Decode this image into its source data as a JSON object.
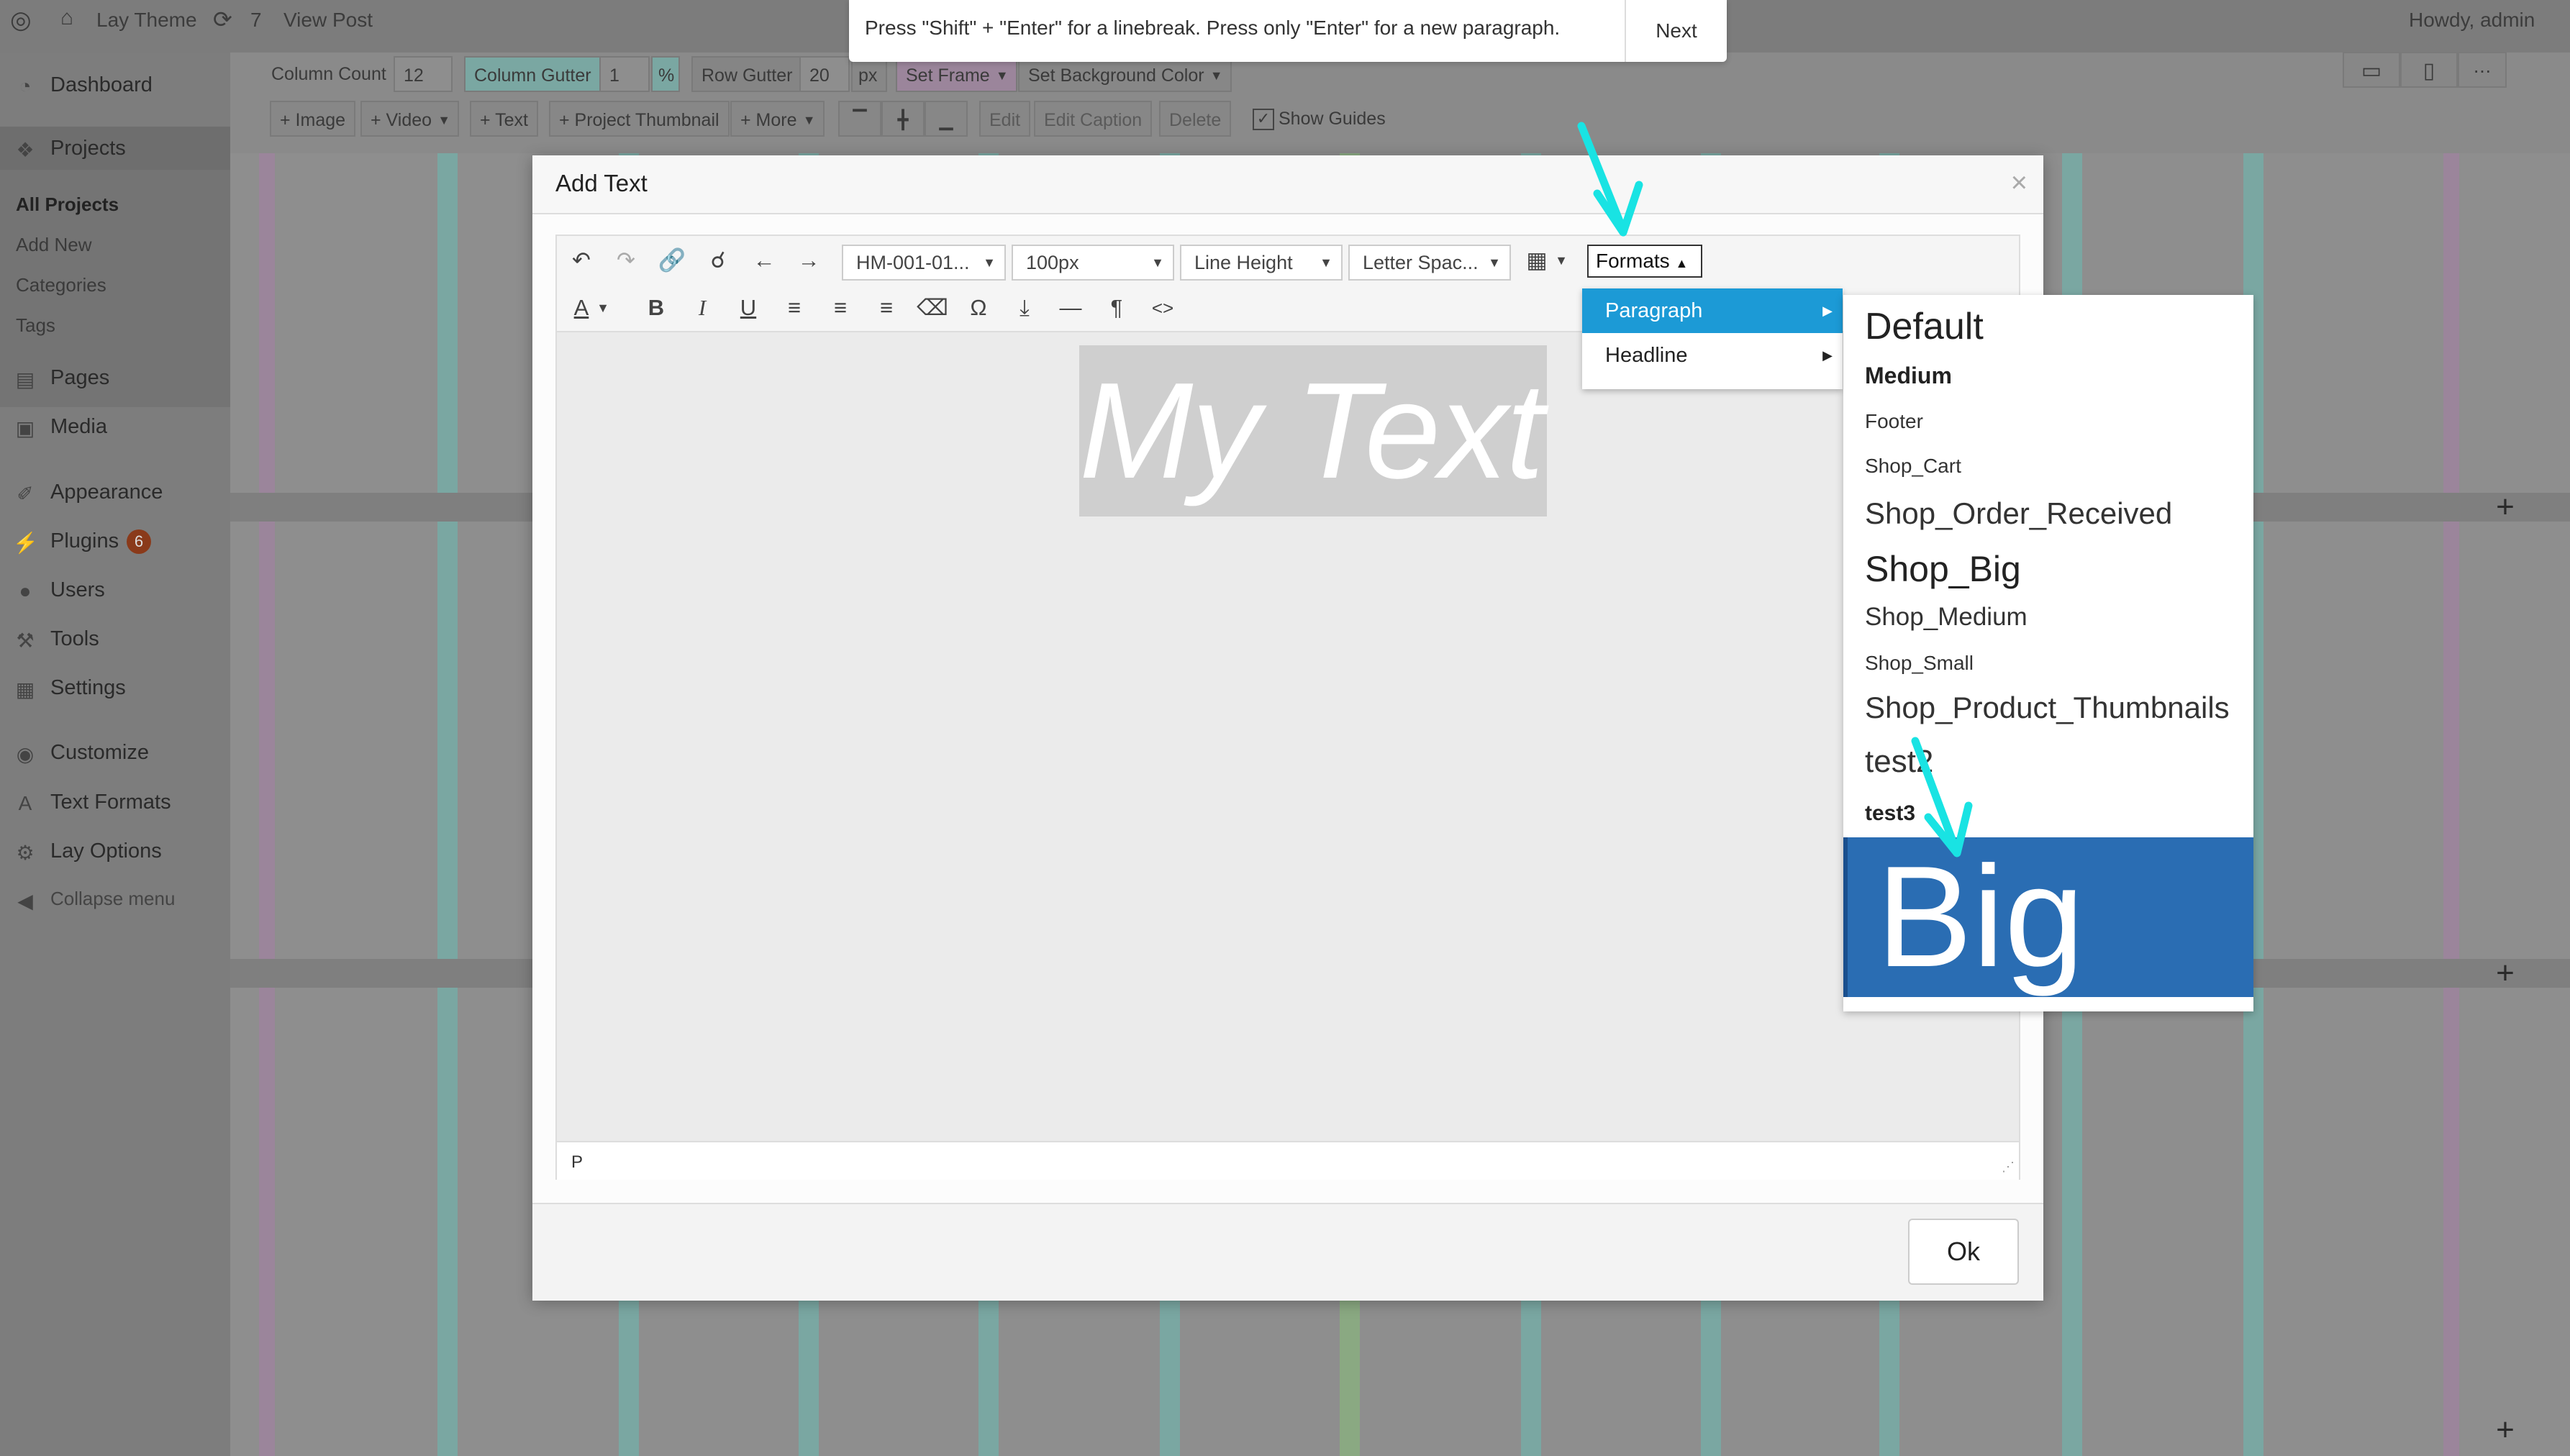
{
  "admin_bar": {
    "site_name": "Lay Theme",
    "updates": "7",
    "view_post": "View Post",
    "howdy": "Howdy, admin"
  },
  "sidebar": {
    "items": [
      {
        "label": "Dashboard",
        "icon": "dashboard-icon"
      },
      {
        "label": "Projects",
        "icon": "pin-icon"
      },
      {
        "label": "Pages",
        "icon": "pages-icon"
      },
      {
        "label": "Media",
        "icon": "media-icon"
      },
      {
        "label": "Appearance",
        "icon": "brush-icon"
      },
      {
        "label": "Plugins",
        "icon": "plugin-icon",
        "badge": "6"
      },
      {
        "label": "Users",
        "icon": "user-icon"
      },
      {
        "label": "Tools",
        "icon": "wrench-icon"
      },
      {
        "label": "Settings",
        "icon": "settings-icon"
      },
      {
        "label": "Customize",
        "icon": "eye-icon"
      },
      {
        "label": "Text Formats",
        "icon": "letter-a-icon"
      },
      {
        "label": "Lay Options",
        "icon": "gear-icon"
      },
      {
        "label": "Collapse menu",
        "icon": "collapse-icon"
      }
    ],
    "projects_sub": [
      "All Projects",
      "Add New",
      "Categories",
      "Tags"
    ]
  },
  "grid_toolbar": {
    "column_count_label": "Column Count",
    "column_count_value": "12",
    "column_gutter_label": "Column Gutter",
    "column_gutter_value": "1",
    "column_gutter_unit": "%",
    "row_gutter_label": "Row Gutter",
    "row_gutter_value": "20",
    "row_gutter_unit": "px",
    "set_frame": "Set Frame",
    "set_bg": "Set Background Color",
    "buttons": [
      "Image",
      "Video",
      "Text",
      "Project Thumbnail",
      "More"
    ],
    "edit": "Edit",
    "edit_caption": "Edit Caption",
    "delete": "Delete",
    "show_guides": "Show Guides"
  },
  "tooltip": {
    "message": "Press \"Shift\" + \"Enter\" for a linebreak. Press only \"Enter\" for a new paragraph.",
    "next": "Next"
  },
  "modal": {
    "title": "Add Text",
    "font_select": "HM-001-01...",
    "size_select": "100px",
    "line_height_select": "Line Height",
    "letter_spacing_select": "Letter Spac...",
    "formats_button": "Formats",
    "editor_text": "My Text",
    "status_path": "P",
    "ok": "Ok"
  },
  "formats_menu": {
    "level1": [
      {
        "label": "Paragraph",
        "active": true
      },
      {
        "label": "Headline",
        "active": false
      }
    ],
    "level2": [
      "Default",
      "Medium",
      "Footer",
      "Shop_Cart",
      "Shop_Order_Received",
      "Shop_Big",
      "Shop_Medium",
      "Shop_Small",
      "Shop_Product_Thumbnails",
      "test2",
      "test3",
      "Big"
    ],
    "selected": "Big"
  },
  "colors": {
    "accent": "#2a6db3",
    "menu_active": "#1c9ad6",
    "arrow": "#19e3e3"
  }
}
